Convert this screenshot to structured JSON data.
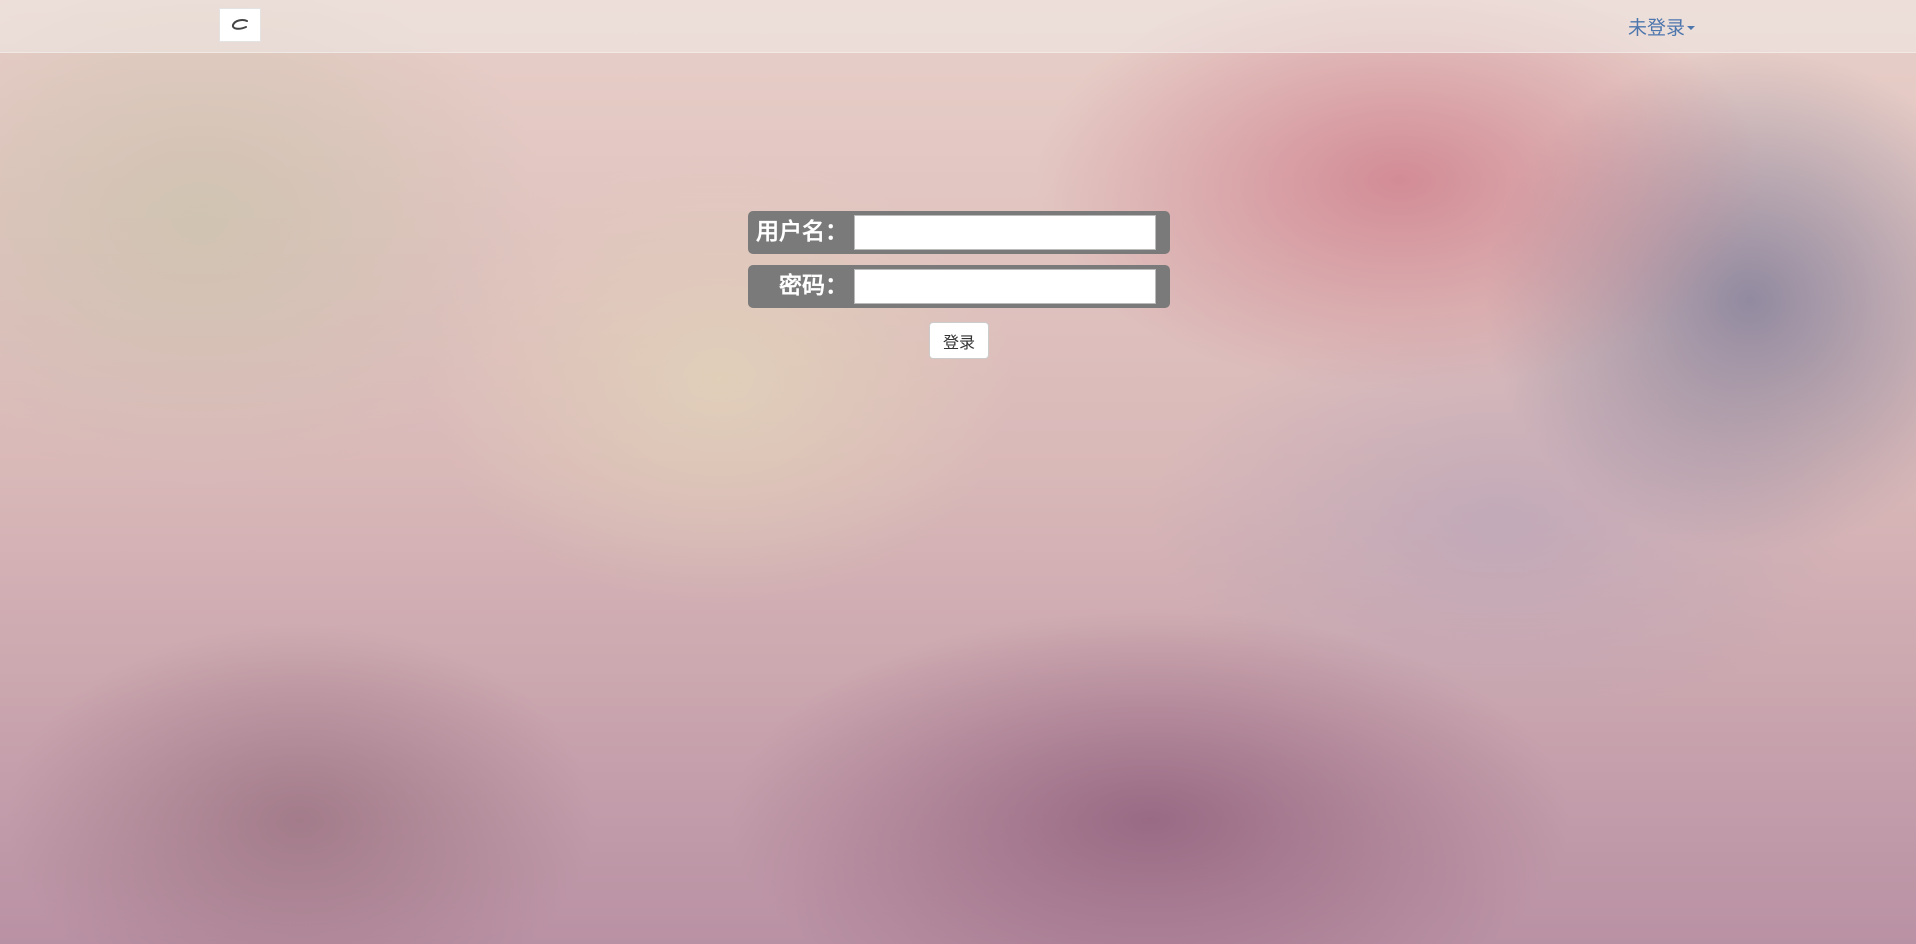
{
  "navbar": {
    "logo_icon": "brand-logo-icon",
    "user_menu_label": "未登录",
    "user_menu_caret_icon": "caret-down-icon"
  },
  "login_form": {
    "username_label": "用户名：",
    "username_value": "",
    "password_label": "密码：",
    "password_value": "",
    "submit_label": "登录"
  },
  "colors": {
    "user_menu_link": "#4d76ad",
    "label_background": "#7a7a7a",
    "label_text": "#ffffff"
  }
}
